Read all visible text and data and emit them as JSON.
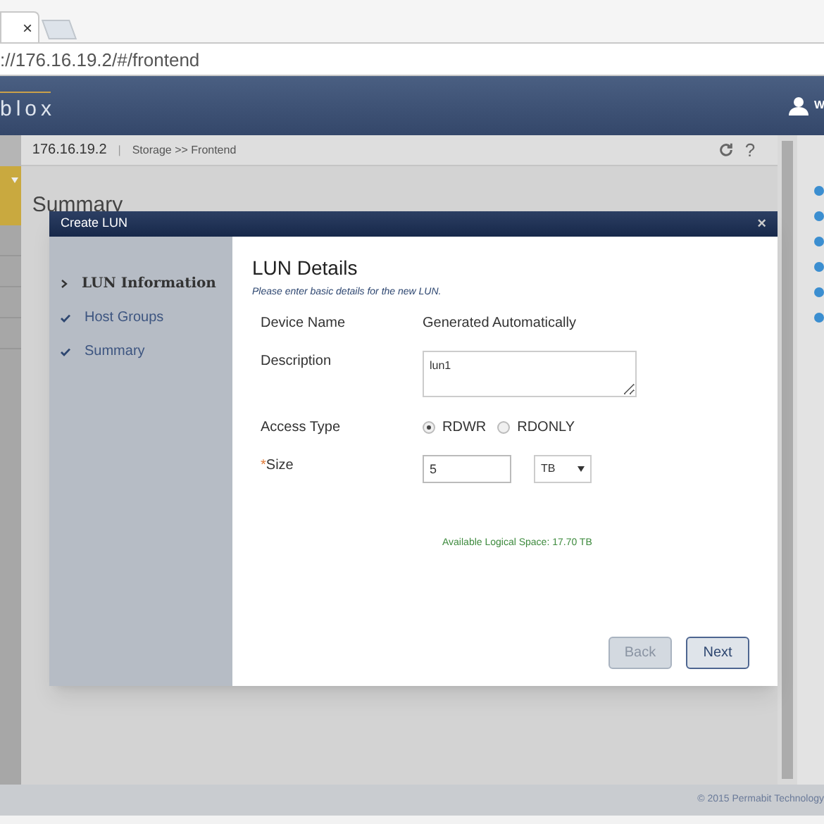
{
  "browser": {
    "tab_close": "×",
    "address": "://176.16.19.2/#/frontend"
  },
  "header": {
    "logo": "blox",
    "user_label": "W"
  },
  "breadcrumb": {
    "host": "176.16.19.2",
    "separator": "|",
    "path": "Storage >> Frontend",
    "help": "?"
  },
  "page": {
    "heading": "Summary"
  },
  "modal": {
    "title": "Create LUN",
    "close": "×",
    "steps": [
      {
        "label": "LUN Information",
        "selected": true
      },
      {
        "label": "Host Groups",
        "selected": false
      },
      {
        "label": "Summary",
        "selected": false
      }
    ],
    "section_title": "LUN Details",
    "hint": "Please enter basic details for the new LUN.",
    "device_name": {
      "label": "Device Name",
      "value": "Generated Automatically"
    },
    "description": {
      "label": "Description",
      "value": "lun1"
    },
    "access_type": {
      "label": "Access Type",
      "options": [
        {
          "label": "RDWR",
          "selected": true
        },
        {
          "label": "RDONLY",
          "selected": false
        }
      ]
    },
    "size": {
      "required_mark": "*",
      "label": "Size",
      "value": "5",
      "unit": "TB"
    },
    "available_space": "Available Logical Space: 17.70 TB",
    "buttons": [
      {
        "label": "Back",
        "disabled": true
      },
      {
        "label": "Next",
        "disabled": false
      }
    ]
  },
  "footer": "© 2015 Permabit Technology"
}
